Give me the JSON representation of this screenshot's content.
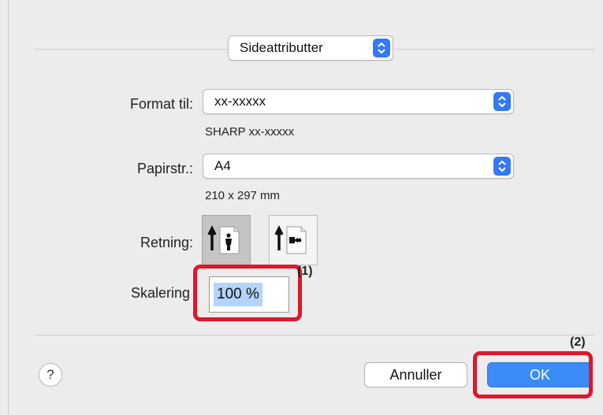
{
  "header": {
    "panel_select": "Sideattributter"
  },
  "form": {
    "format_label": "Format til:",
    "format_value": "xx-xxxxx",
    "format_sub": "SHARP xx-xxxxx",
    "paper_label": "Papirstr.:",
    "paper_value": "A4",
    "paper_sub": "210 x 297 mm",
    "orientation_label": "Retning:",
    "orientation_options": [
      "portrait",
      "landscape"
    ],
    "orientation_selected": "portrait",
    "scale_label": "Skalering",
    "scale_value": "100 %"
  },
  "callouts": {
    "c1": "(1)",
    "c2": "(2)"
  },
  "footer": {
    "help_label": "?",
    "cancel_label": "Annuller",
    "ok_label": "OK"
  },
  "colors": {
    "accent": "#3478f6",
    "highlight_box": "#e0162b",
    "selection": "#b3d4fc"
  },
  "icons": [
    "chevron-updown-icon",
    "portrait-orientation-icon",
    "landscape-orientation-icon",
    "help-icon"
  ]
}
